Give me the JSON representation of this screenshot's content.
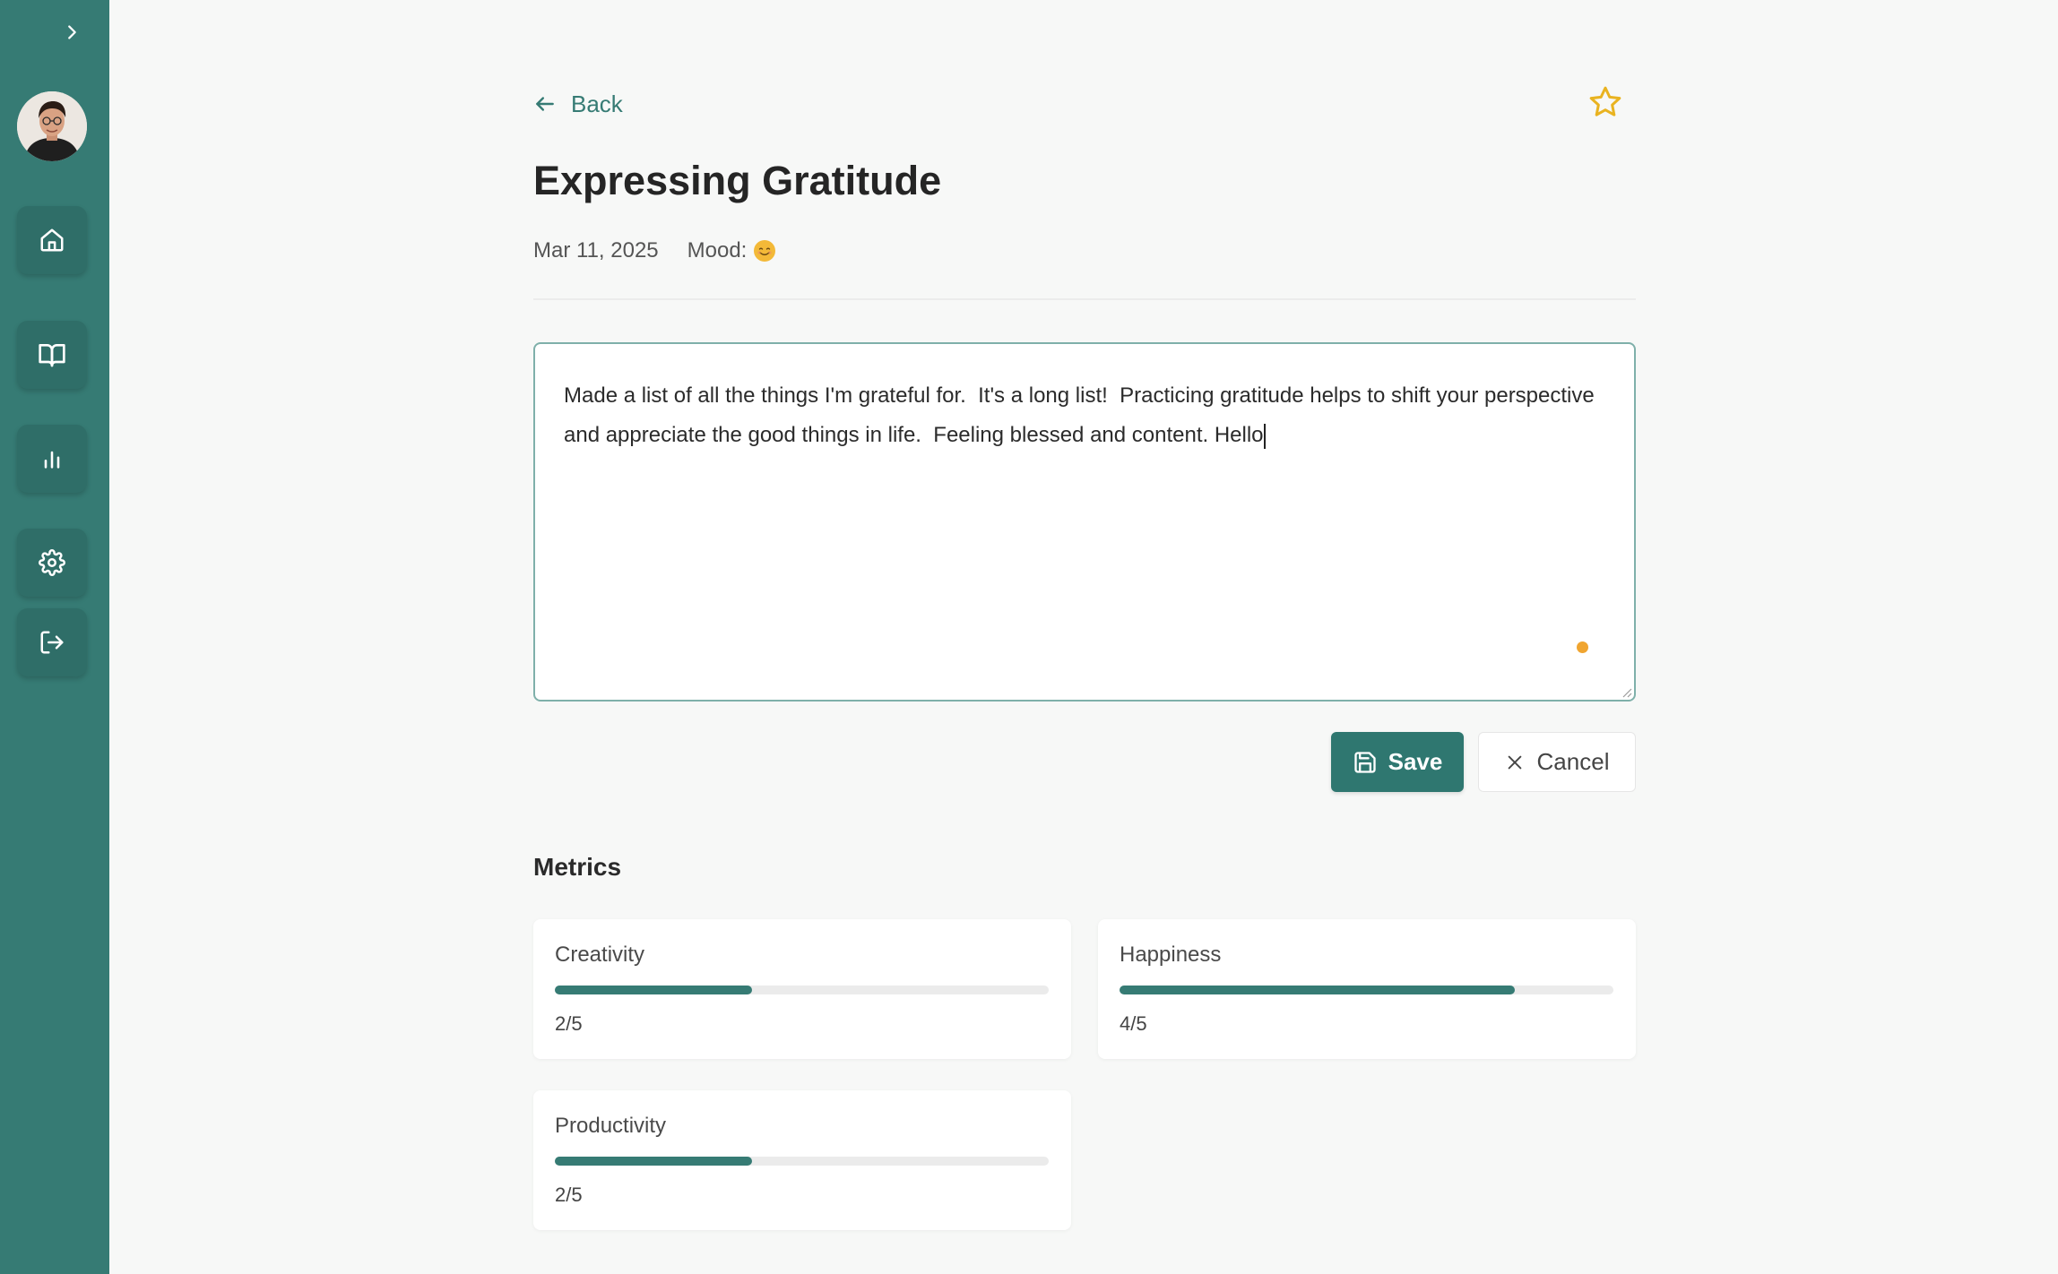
{
  "sidebar": {
    "toggle_icon": "chevron-right-icon",
    "avatar_alt": "",
    "items": [
      {
        "name": "home",
        "icon": "home-icon"
      },
      {
        "name": "journal",
        "icon": "book-open-icon"
      },
      {
        "name": "stats",
        "icon": "bar-chart-icon"
      },
      {
        "name": "settings",
        "icon": "gear-icon"
      },
      {
        "name": "logout",
        "icon": "logout-icon"
      }
    ],
    "color": "#367b74"
  },
  "header": {
    "back_label": "Back",
    "favorite_icon": "star-icon"
  },
  "entry": {
    "title": "Expressing Gratitude",
    "date": "Mar 11, 2025",
    "mood_label": "Mood:",
    "mood_icon": "smiley-emoji",
    "text": "Made a list of all the things I'm grateful for.  It's a long list!  Practicing gratitude helps to shift your perspective and appreciate the good things in life.  Feeling blessed and content. Hello"
  },
  "actions": {
    "save_label": "Save",
    "cancel_label": "Cancel"
  },
  "metrics": {
    "title": "Metrics",
    "items": [
      {
        "label": "Creativity",
        "value": 2,
        "max": 5,
        "display": "2/5"
      },
      {
        "label": "Happiness",
        "value": 4,
        "max": 5,
        "display": "4/5"
      },
      {
        "label": "Productivity",
        "value": 2,
        "max": 5,
        "display": "2/5"
      }
    ]
  },
  "colors": {
    "accent": "#367b74",
    "star": "#e9b320",
    "mood": "#f3b938",
    "indicator": "#f0a530"
  }
}
